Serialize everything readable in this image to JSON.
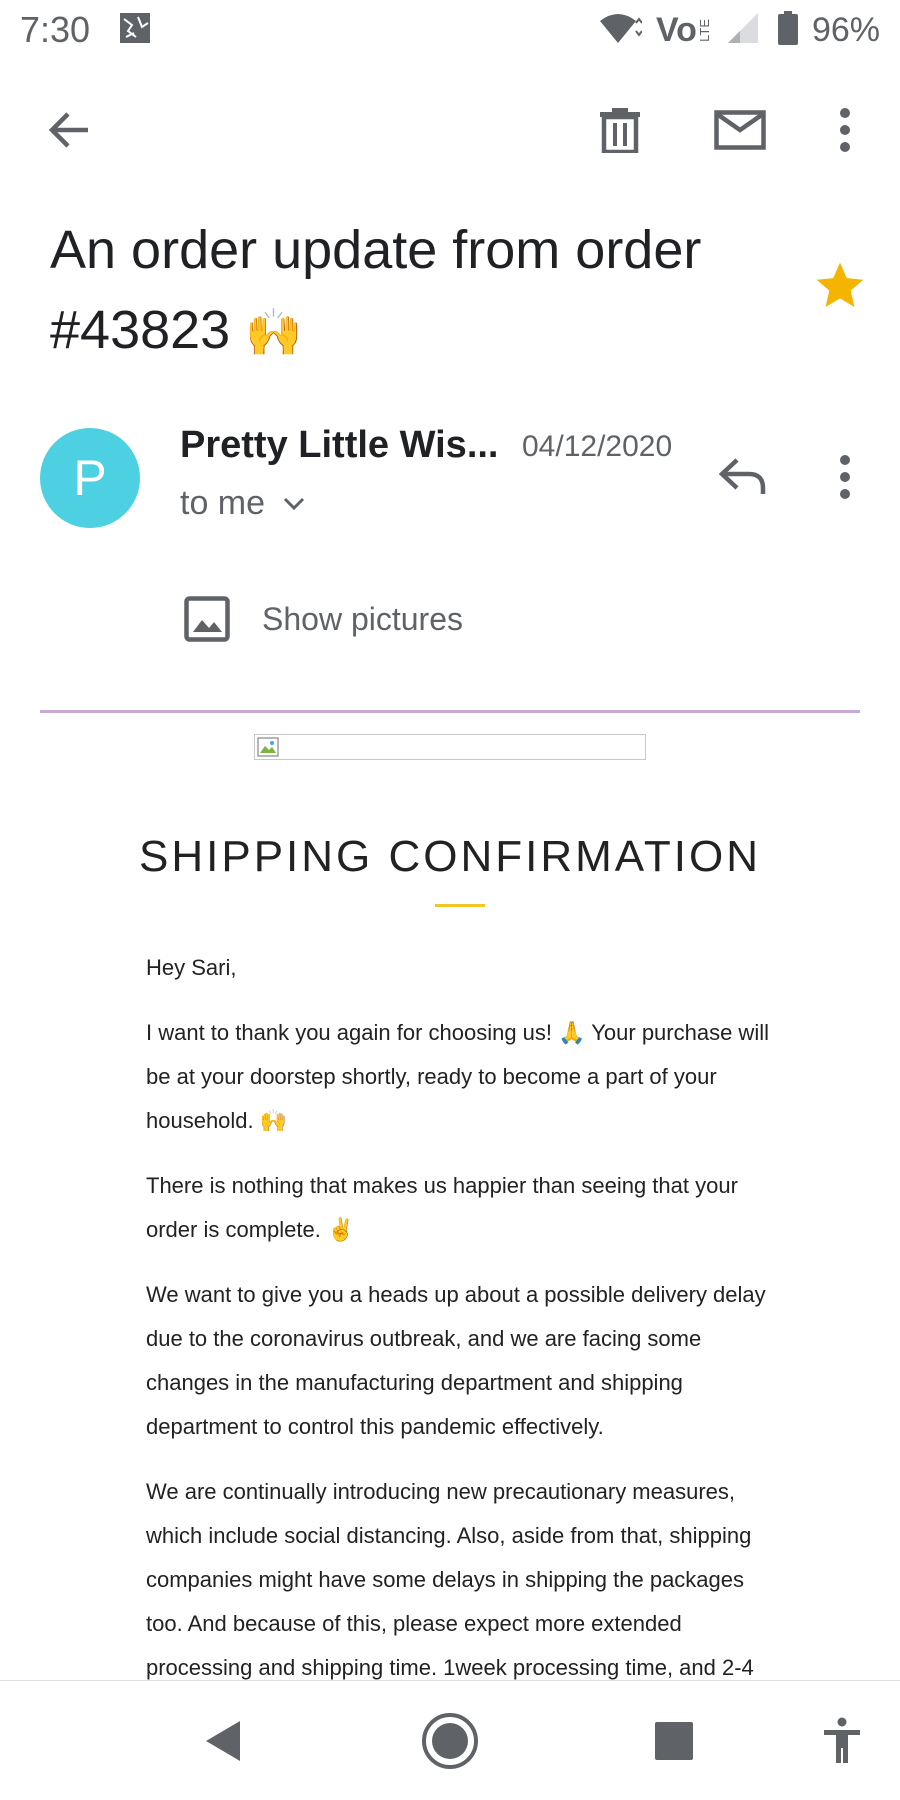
{
  "status_bar": {
    "time": "7:30",
    "network_label": "Vo",
    "network_sub": "LTE",
    "battery": "96%"
  },
  "toolbar": {
    "back_icon": "arrow-left-icon",
    "delete_icon": "trash-icon",
    "mark_unread_icon": "mail-icon",
    "more_icon": "more-vert-icon"
  },
  "email": {
    "subject": "An order update from order #43823",
    "subject_emoji": "🙌",
    "starred": true,
    "star_color": "#f4b400",
    "sender": {
      "avatar_letter": "P",
      "avatar_color": "#4dd0e1",
      "name": "Pretty Little Wis...",
      "date": "04/12/2020",
      "recipient": "to me"
    },
    "show_pictures_label": "Show pictures",
    "content": {
      "heading": "SHIPPING CONFIRMATION",
      "greeting": "Hey Sari,",
      "paragraphs": [
        "I want to thank you again for choosing us! 🙏 Your purchase will be at your doorstep shortly, ready to become a part of your household. 🙌",
        "There is nothing that makes us happier than seeing that your order is complete. ✌️",
        "We want to give you a heads up about a possible delivery delay due to the coronavirus outbreak, and we are facing some changes in the manufacturing department and shipping department to control this pandemic effectively.",
        "We are continually introducing new precautionary measures, which include social distancing. Also, aside from that, shipping companies might have some delays in shipping the packages too. And because of this, please expect more extended processing and shipping time. 1week processing time, and 2-4"
      ]
    }
  },
  "nav_bar": {
    "back_icon": "nav-back-icon",
    "home_icon": "nav-home-icon",
    "recents_icon": "nav-recents-icon",
    "accessibility_icon": "accessibility-icon"
  },
  "colors": {
    "accent_divider": "#c9a9d5",
    "heading_underline": "#f3c623",
    "icon_gray": "#5f6368"
  }
}
